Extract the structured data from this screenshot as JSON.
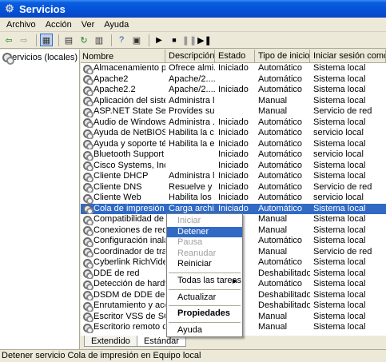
{
  "window": {
    "title": "Servicios"
  },
  "menubar": [
    "Archivo",
    "Acción",
    "Ver",
    "Ayuda"
  ],
  "tree": {
    "root": "Servicios (locales)"
  },
  "columns": [
    "Nombre",
    "Descripción",
    "Estado",
    "Tipo de inicio",
    "Iniciar sesión como"
  ],
  "rows": [
    [
      "Almacenamiento pr...",
      "Ofrece almi...",
      "Iniciado",
      "Automático",
      "Sistema local"
    ],
    [
      "Apache2",
      "Apache/2....",
      "",
      "Automático",
      "Sistema local"
    ],
    [
      "Apache2.2",
      "Apache/2....",
      "Iniciado",
      "Automático",
      "Sistema local"
    ],
    [
      "Aplicación del siste...",
      "Administra l...",
      "",
      "Manual",
      "Sistema local"
    ],
    [
      "ASP.NET State Serv...",
      "Provides su...",
      "",
      "Manual",
      "Servicio de red"
    ],
    [
      "Audio de Windows",
      "Administra ...",
      "Iniciado",
      "Automático",
      "Sistema local"
    ],
    [
      "Ayuda de NetBIOS ...",
      "Habilita la c...",
      "Iniciado",
      "Automático",
      "servicio local"
    ],
    [
      "Ayuda y soporte té...",
      "Habilita la e...",
      "Iniciado",
      "Automático",
      "Sistema local"
    ],
    [
      "Bluetooth Support S...",
      "",
      "Iniciado",
      "Automático",
      "servicio local"
    ],
    [
      "Cisco Systems, Inc....",
      "",
      "Iniciado",
      "Automático",
      "Sistema local"
    ],
    [
      "Cliente DHCP",
      "Administra l...",
      "Iniciado",
      "Automático",
      "Sistema local"
    ],
    [
      "Cliente DNS",
      "Resuelve y ...",
      "Iniciado",
      "Automático",
      "Servicio de red"
    ],
    [
      "Cliente Web",
      "Habilita los ...",
      "Iniciado",
      "Automático",
      "servicio local"
    ],
    [
      "Cola de impresión",
      "Carga archi...",
      "Iniciado",
      "Automático",
      "Sistema local"
    ],
    [
      "Compatibilidad de c...",
      "",
      "",
      "Manual",
      "Sistema local"
    ],
    [
      "Conexiones de red",
      "",
      "",
      "Manual",
      "Sistema local"
    ],
    [
      "Configuración inalá...",
      "",
      "",
      "Automático",
      "Sistema local"
    ],
    [
      "Coordinador de tra...",
      "",
      "",
      "Manual",
      "Servicio de red"
    ],
    [
      "Cyberlink RichVideo ...",
      "",
      "",
      "Automático",
      "Sistema local"
    ],
    [
      "DDE de red",
      "",
      "",
      "Deshabilitado",
      "Sistema local"
    ],
    [
      "Detección de hardw...",
      "",
      "",
      "Automático",
      "Sistema local"
    ],
    [
      "DSDM de DDE de red",
      "",
      "",
      "Deshabilitado",
      "Sistema local"
    ],
    [
      "Enrutamiento y acc...",
      "",
      "",
      "Deshabilitado",
      "Sistema local"
    ],
    [
      "Escritor VSS de SQL...",
      "",
      "",
      "Manual",
      "Sistema local"
    ],
    [
      "Escritorio remoto co...",
      "",
      "",
      "Manual",
      "Sistema local"
    ]
  ],
  "selected_row": 13,
  "context_menu": {
    "items": [
      {
        "label": "Iniciar",
        "state": "disabled"
      },
      {
        "label": "Detener",
        "state": "hover"
      },
      {
        "label": "Pausa",
        "state": "disabled"
      },
      {
        "label": "Reanudar",
        "state": "disabled"
      },
      {
        "label": "Reiniciar",
        "state": "normal"
      },
      {
        "sep": true
      },
      {
        "label": "Todas las tareas",
        "state": "normal",
        "submenu": true
      },
      {
        "sep": true
      },
      {
        "label": "Actualizar",
        "state": "normal"
      },
      {
        "sep": true
      },
      {
        "label": "Propiedades",
        "state": "bold"
      },
      {
        "sep": true
      },
      {
        "label": "Ayuda",
        "state": "normal"
      }
    ]
  },
  "tabs": [
    "Extendido",
    "Estándar"
  ],
  "active_tab": 1,
  "status": "Detener servicio Cola de impresión en Equipo local",
  "colors": {
    "title_bar": "#0451d8",
    "selection": "#316ac5",
    "face": "#ece9d8"
  }
}
